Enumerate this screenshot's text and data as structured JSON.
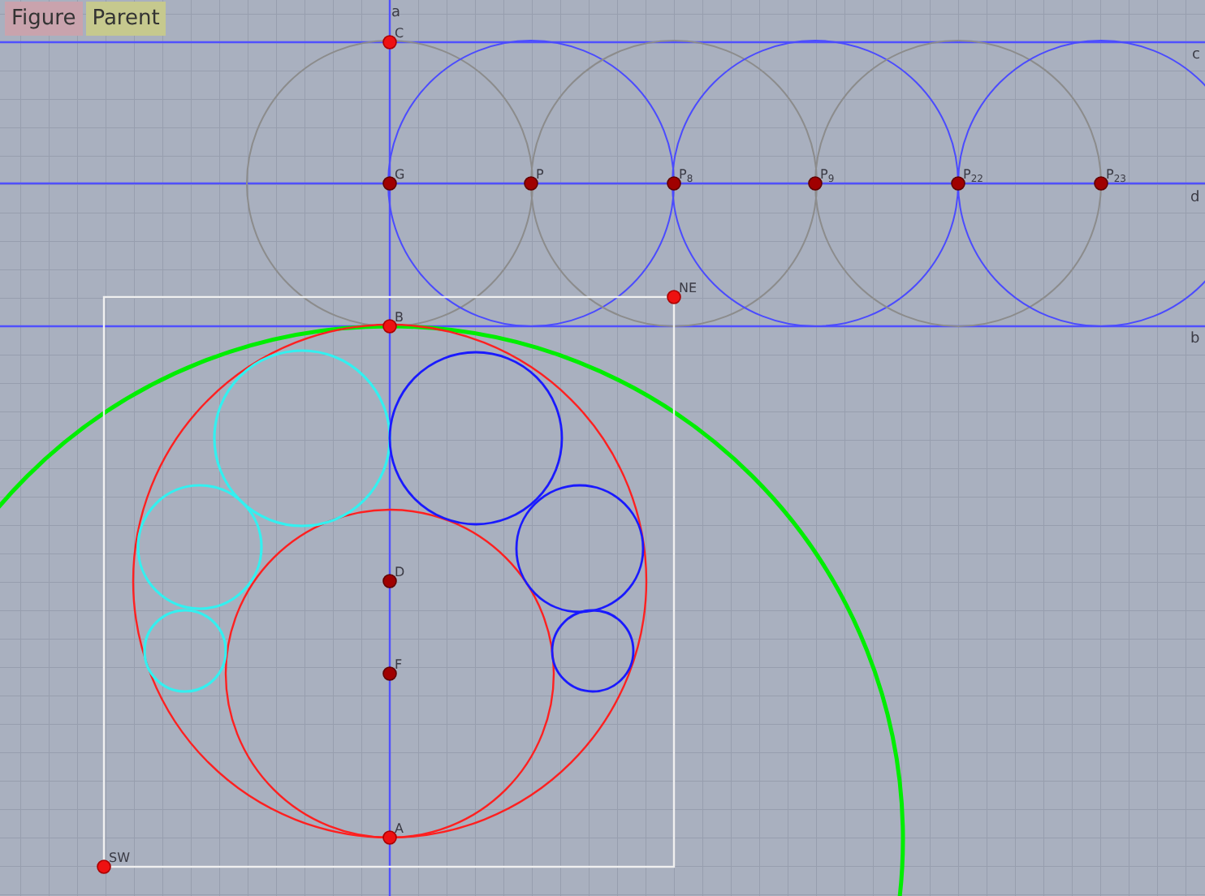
{
  "toolbar": [
    {
      "label": "Figure",
      "color": "#c9a3ad"
    },
    {
      "label": "Parent",
      "color": "#c6c98e"
    }
  ],
  "lines": [
    {
      "label": "a"
    },
    {
      "label": "c"
    },
    {
      "label": "d"
    },
    {
      "label": "b"
    }
  ],
  "points": [
    {
      "label": "C",
      "kind": "free"
    },
    {
      "label": "G",
      "kind": "dependent"
    },
    {
      "label": "P",
      "kind": "dependent"
    },
    {
      "label": "P$_{8}$",
      "kind": "dependent"
    },
    {
      "label": "P$_{9}$",
      "kind": "dependent"
    },
    {
      "label": "P$_{22}$",
      "kind": "dependent"
    },
    {
      "label": "P$_{23}$",
      "kind": "dependent"
    },
    {
      "label": "NE",
      "kind": "free"
    },
    {
      "label": "B",
      "kind": "free"
    },
    {
      "label": "D",
      "kind": "dependent"
    },
    {
      "label": "F",
      "kind": "dependent"
    },
    {
      "label": "A",
      "kind": "free"
    },
    {
      "label": "SW",
      "kind": "free"
    }
  ]
}
